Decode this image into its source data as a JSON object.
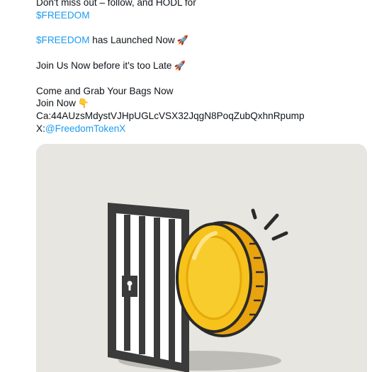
{
  "tweet": {
    "line1_text": "Don't miss out – follow, and HODL for",
    "hashtag1": "$FREEDOM",
    "hashtag2": "$FREEDOM",
    "launch_text": " has Launched Now",
    "launch_emoji": "🚀",
    "join_text": "Join Us Now before it's too Late",
    "join_emoji": "🚀",
    "grab_text": "Come and Grab Your Bags Now",
    "join_now_text": "Join Now",
    "join_now_emoji": "👇",
    "contract_text": "Ca:44AUzsMdystVJHpUGLcVSX32JqgN8PoqZubQxhnRpump",
    "x_prefix": "X:",
    "x_handle": "@FreedomTokenX"
  },
  "media": {
    "image_name": "coin-escaping-jail-door-illustration",
    "background_color": "#e7e6e1",
    "coin_color": "#f7c21b",
    "door_color": "#3b3b3b"
  }
}
